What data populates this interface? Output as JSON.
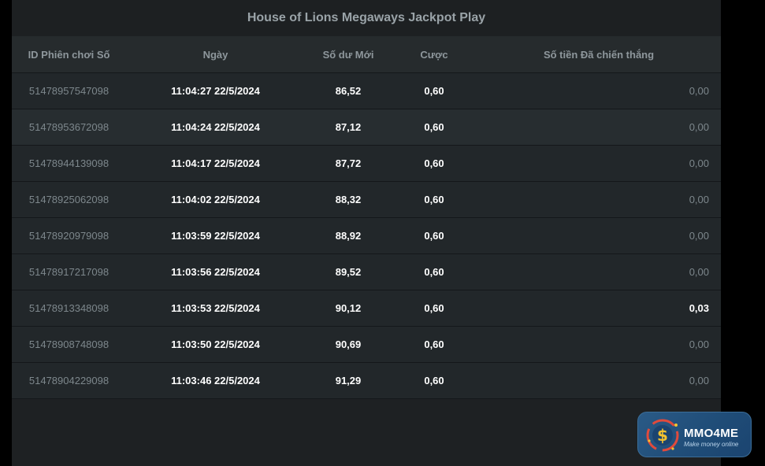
{
  "title": "House of Lions Megaways Jackpot Play",
  "columns": {
    "id": "ID Phiên chơi Số",
    "date": "Ngày",
    "balance": "Số dư Mới",
    "bet": "Cược",
    "win": "Số tiền Đã chiến thắng"
  },
  "rows": [
    {
      "id": "51478957547098",
      "date": "11:04:27 22/5/2024",
      "balance": "86,52",
      "bet": "0,60",
      "win": "0,00"
    },
    {
      "id": "51478953672098",
      "date": "11:04:24 22/5/2024",
      "balance": "87,12",
      "bet": "0,60",
      "win": "0,00"
    },
    {
      "id": "51478944139098",
      "date": "11:04:17 22/5/2024",
      "balance": "87,72",
      "bet": "0,60",
      "win": "0,00"
    },
    {
      "id": "51478925062098",
      "date": "11:04:02 22/5/2024",
      "balance": "88,32",
      "bet": "0,60",
      "win": "0,00"
    },
    {
      "id": "51478920979098",
      "date": "11:03:59 22/5/2024",
      "balance": "88,92",
      "bet": "0,60",
      "win": "0,00"
    },
    {
      "id": "51478917217098",
      "date": "11:03:56 22/5/2024",
      "balance": "89,52",
      "bet": "0,60",
      "win": "0,00"
    },
    {
      "id": "51478913348098",
      "date": "11:03:53 22/5/2024",
      "balance": "90,12",
      "bet": "0,60",
      "win": "0,03"
    },
    {
      "id": "51478908748098",
      "date": "11:03:50 22/5/2024",
      "balance": "90,69",
      "bet": "0,60",
      "win": "0,00"
    },
    {
      "id": "51478904229098",
      "date": "11:03:46 22/5/2024",
      "balance": "91,29",
      "bet": "0,60",
      "win": "0,00"
    }
  ],
  "watermark": {
    "name": "MMO4ME",
    "tagline": "Make money online",
    "icon": "dollar-coin-icon"
  },
  "colors": {
    "background": "#000000",
    "panel": "#1e2123",
    "header": "#262b2d",
    "muted_text": "#7d878c",
    "bright_text": "#ffffff",
    "logo_blue": "#1f4c77"
  }
}
